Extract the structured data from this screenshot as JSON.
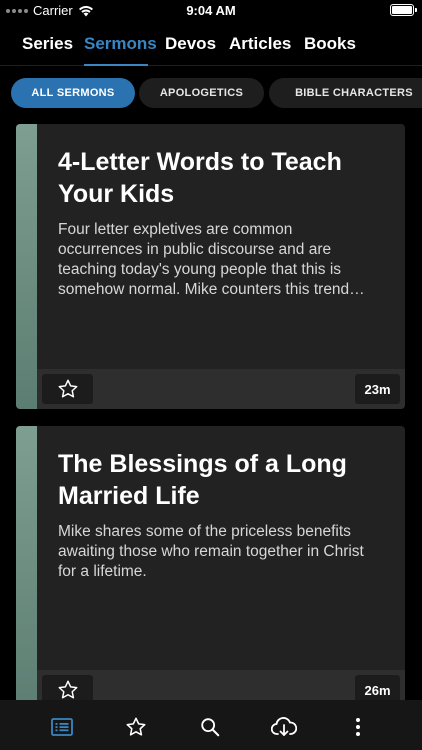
{
  "status_bar": {
    "carrier": "Carrier",
    "time": "9:04 AM"
  },
  "top_nav": {
    "tabs": [
      {
        "label": "Series"
      },
      {
        "label": "Sermons"
      },
      {
        "label": "Devos"
      },
      {
        "label": "Articles"
      },
      {
        "label": "Books"
      }
    ],
    "active_tab": "Sermons"
  },
  "categories": {
    "chips": [
      {
        "label": "ALL SERMONS"
      },
      {
        "label": "APOLOGETICS"
      },
      {
        "label": "BIBLE CHARACTERS"
      }
    ],
    "selected": "ALL SERMONS"
  },
  "sermons": [
    {
      "title_line1": "4-Letter Words to Teach",
      "title_line2": "Your Kids",
      "desc_lines": [
        "Four letter expletives are common",
        "occurrences in public discourse and are",
        "teaching today's young people that this is",
        "somehow normal. Mike counters this trend…"
      ],
      "duration": "23m"
    },
    {
      "title_line1": "The Blessings of a Long",
      "title_line2": "Married Life",
      "desc_lines": [
        "Mike shares some of the priceless benefits",
        "awaiting those who remain together in Christ",
        "for a lifetime."
      ],
      "duration": "26m"
    }
  ],
  "bottom_bar": {
    "items": [
      "list-icon",
      "star-icon",
      "search-icon",
      "cloud-download-icon",
      "more-vertical-icon"
    ]
  },
  "colors": {
    "accent": "#3a86c2",
    "chip_active": "#2a73b0",
    "card_bg": "#222222",
    "card_stripe": "#7f9e92"
  }
}
